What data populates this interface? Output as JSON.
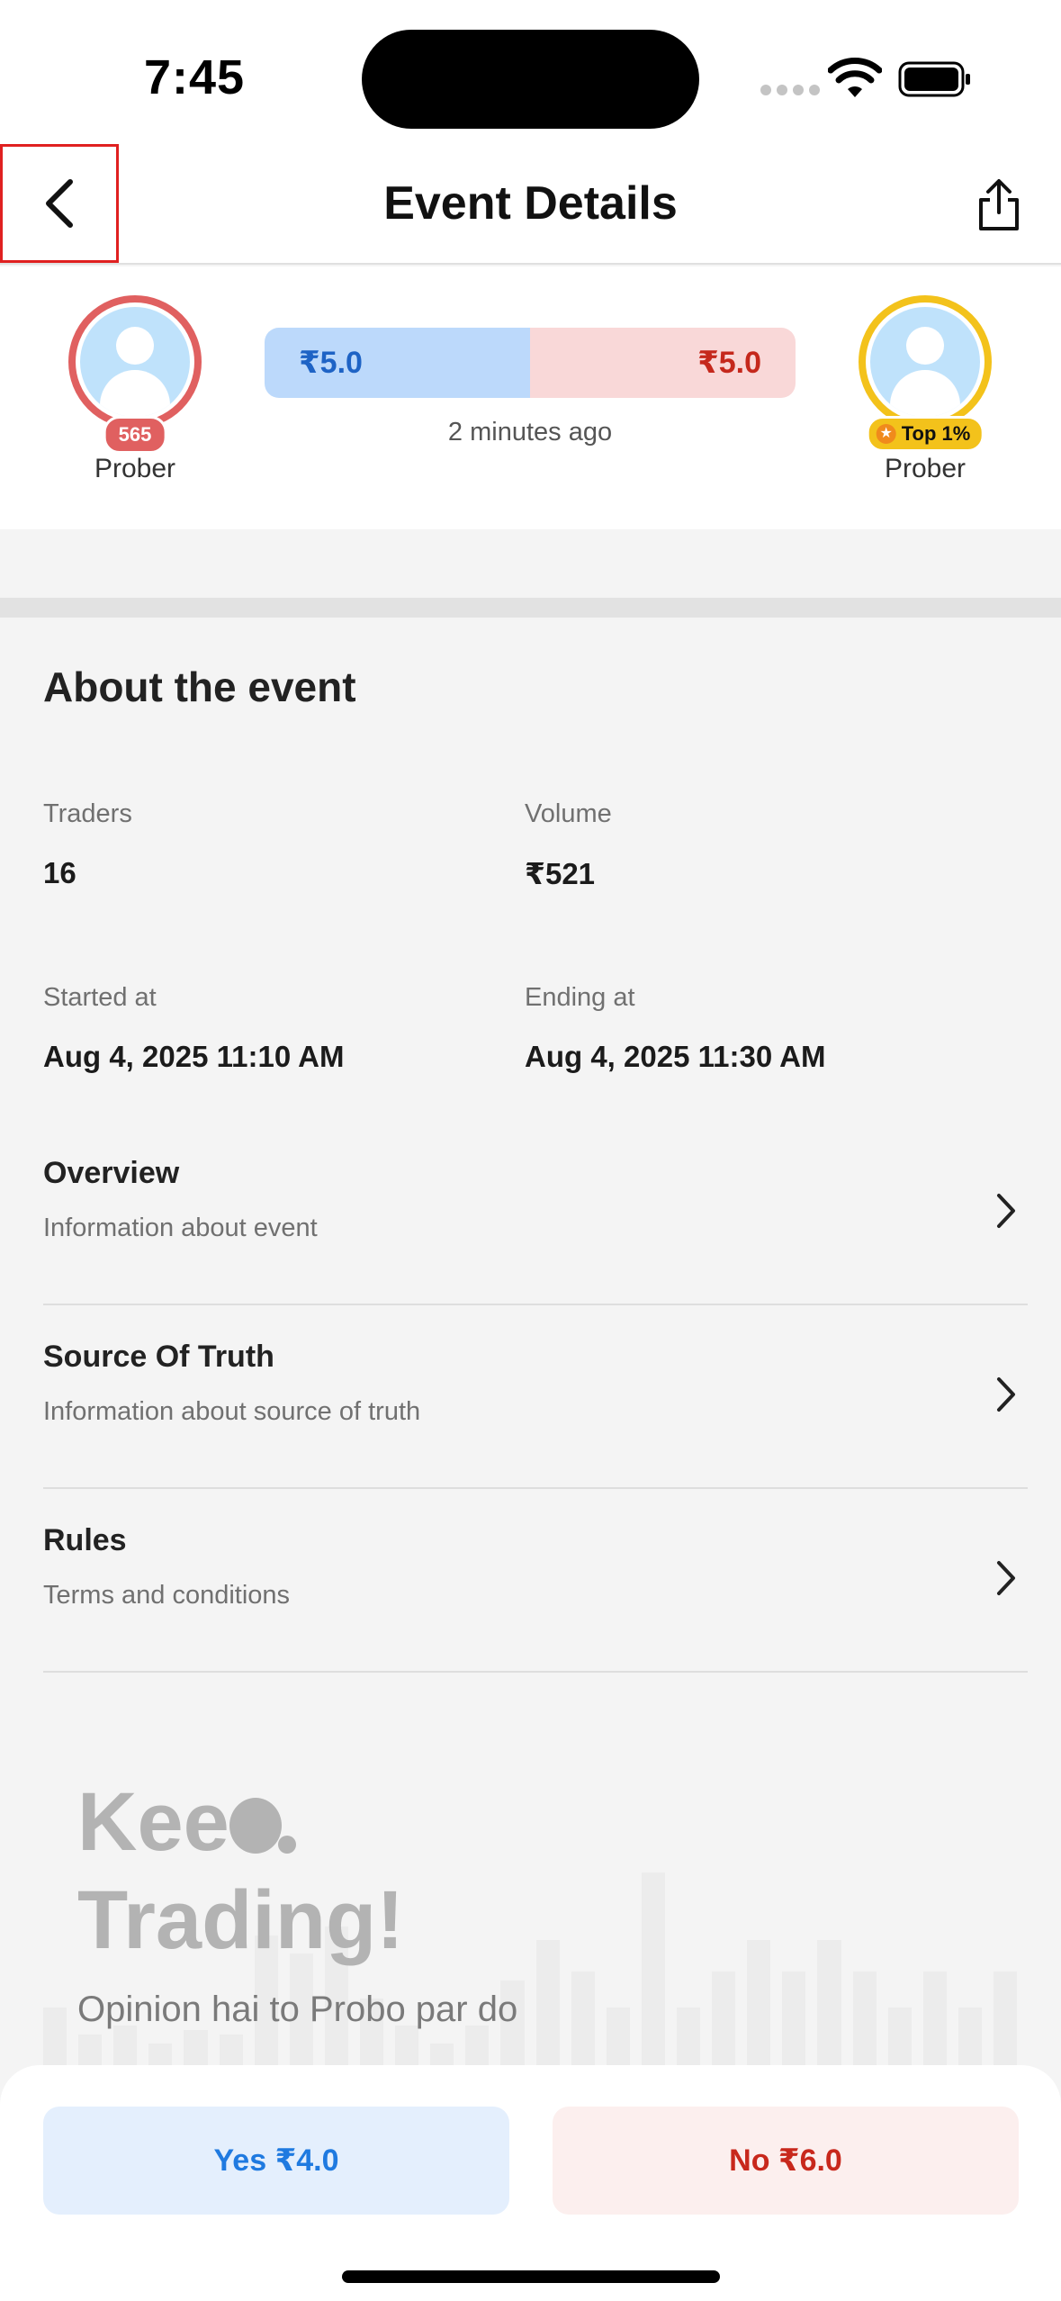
{
  "status_bar": {
    "time": "7:45"
  },
  "header": {
    "title": "Event Details",
    "back_icon": "chevron-left-icon",
    "share_icon": "share-icon"
  },
  "match": {
    "left_player": {
      "name": "Prober",
      "rank_badge": "565",
      "ring_color": "#e06060"
    },
    "right_player": {
      "name": "Prober",
      "top_badge": "Top 1%",
      "ring_color": "#f3c21b"
    },
    "yes_price": "₹5.0",
    "no_price": "₹5.0",
    "time_ago": "2 minutes ago"
  },
  "about": {
    "title": "About the event",
    "traders_label": "Traders",
    "traders_value": "16",
    "volume_label": "Volume",
    "volume_value": "₹521",
    "started_label": "Started at",
    "started_value": "Aug 4, 2025 11:10 AM",
    "ending_label": "Ending at",
    "ending_value": "Aug 4, 2025 11:30 AM"
  },
  "sections": [
    {
      "title": "Overview",
      "subtitle": "Information about event"
    },
    {
      "title": "Source Of Truth",
      "subtitle": "Information about source of truth"
    },
    {
      "title": "Rules",
      "subtitle": "Terms and conditions"
    }
  ],
  "promo": {
    "title_line1_prefix": "Kee",
    "title_line2": "Trading!",
    "subtitle": "Opinion hai to Probo par do"
  },
  "actions": {
    "yes_label": "Yes ₹4.0",
    "no_label": "No ₹6.0"
  },
  "colors": {
    "yes_blue": "#1f7ae0",
    "no_red": "#c8281c",
    "accent_gold": "#f3c21b"
  }
}
